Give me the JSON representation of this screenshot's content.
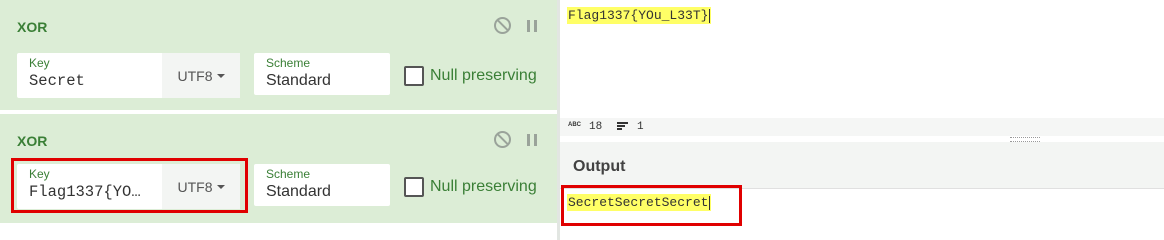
{
  "recipe": {
    "operations": [
      {
        "title": "XOR",
        "key_label": "Key",
        "key_value": "Secret",
        "key_encoding": "UTF8",
        "scheme_label": "Scheme",
        "scheme_value": "Standard",
        "null_preserving_label": "Null preserving",
        "null_preserving_checked": false
      },
      {
        "title": "XOR",
        "key_label": "Key",
        "key_value": "Flag1337{YO…",
        "key_encoding": "UTF8",
        "scheme_label": "Scheme",
        "scheme_value": "Standard",
        "null_preserving_label": "Null preserving",
        "null_preserving_checked": false
      }
    ]
  },
  "input": {
    "text": "Flag1337{YOu_L33T}"
  },
  "status_bar": {
    "abc_label": "ABC",
    "length": "18",
    "lines": "1"
  },
  "output": {
    "title": "Output",
    "text": "SecretSecretSecret"
  },
  "colors": {
    "operation_bg": "#dcedd6",
    "accent_green": "#3a7f36",
    "highlight": "#ffff66",
    "annotation_red": "#e00000"
  }
}
